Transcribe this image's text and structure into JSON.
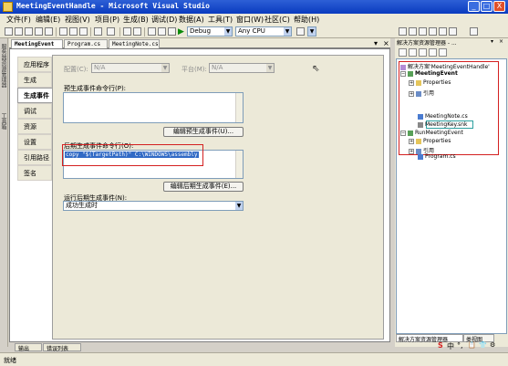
{
  "window": {
    "title": "MeetingEventHandle - Microsoft Visual Studio",
    "controls": [
      "_",
      "□",
      "X"
    ]
  },
  "menu": [
    "文件(F)",
    "编辑(E)",
    "视图(V)",
    "项目(P)",
    "生成(B)",
    "调试(D)",
    "数据(A)",
    "工具(T)",
    "窗口(W)",
    "社区(C)",
    "帮助(H)"
  ],
  "toolbar": {
    "config": "Debug",
    "platform": "Any CPU"
  },
  "doc_tabs": [
    "MeetingEvent",
    "Program.cs",
    "MeetingNote.cs"
  ],
  "doc_tab_controls": [
    "▾",
    "×"
  ],
  "left_strip": [
    "服务器资源管理器",
    "工具箱"
  ],
  "property_tabs": [
    "应用程序",
    "生成",
    "生成事件",
    "调试",
    "资源",
    "设置",
    "引用路径",
    "签名"
  ],
  "build_events": {
    "config_label": "配置(C):",
    "config_value": "N/A",
    "platform_label": "平台(M):",
    "platform_value": "N/A",
    "prebuild_label": "预生成事件命令行(P):",
    "prebuild_value": "",
    "edit_prebuild": "编辑预生成事件(U)...",
    "postbuild_label": "后期生成事件命令行(O):",
    "postbuild_value": "copy \"$(TargetPath)\" C:\\WINDOWS\\assembly",
    "edit_postbuild": "编辑后期生成事件(E)...",
    "run_label": "运行后期生成事件(N):",
    "run_value": "成功生成时"
  },
  "solution_explorer": {
    "title": "解决方案资源管理器 - ...",
    "title_controls": [
      "▾",
      "×"
    ],
    "tree": [
      {
        "label": "解决方案'MeetingEventHandle'",
        "icon": "solution"
      },
      {
        "label": "MeetingEvent",
        "icon": "project"
      },
      {
        "label": "Properties",
        "icon": "folder"
      },
      {
        "label": "引用",
        "icon": "references"
      },
      {
        "label": "MeetingNote.cs",
        "icon": "cs-file"
      },
      {
        "label": "MeetingKey.snk",
        "icon": "key-file"
      },
      {
        "label": "RunMeetingEvent",
        "icon": "project"
      },
      {
        "label": "Properties",
        "icon": "folder"
      },
      {
        "label": "引用",
        "icon": "references"
      },
      {
        "label": "Program.cs",
        "icon": "cs-file"
      }
    ],
    "tabs": [
      "解决方案资源管理器",
      "类视图"
    ]
  },
  "bottom_tabs": [
    "输出",
    "错误列表"
  ],
  "ime": [
    "S",
    "中",
    "°,",
    "📋",
    "👕",
    "⚙"
  ],
  "status": "就绪",
  "colors": {
    "title_bar": "#0a3bbf",
    "selection": "#316ac5",
    "highlight_box": "#d42020"
  }
}
